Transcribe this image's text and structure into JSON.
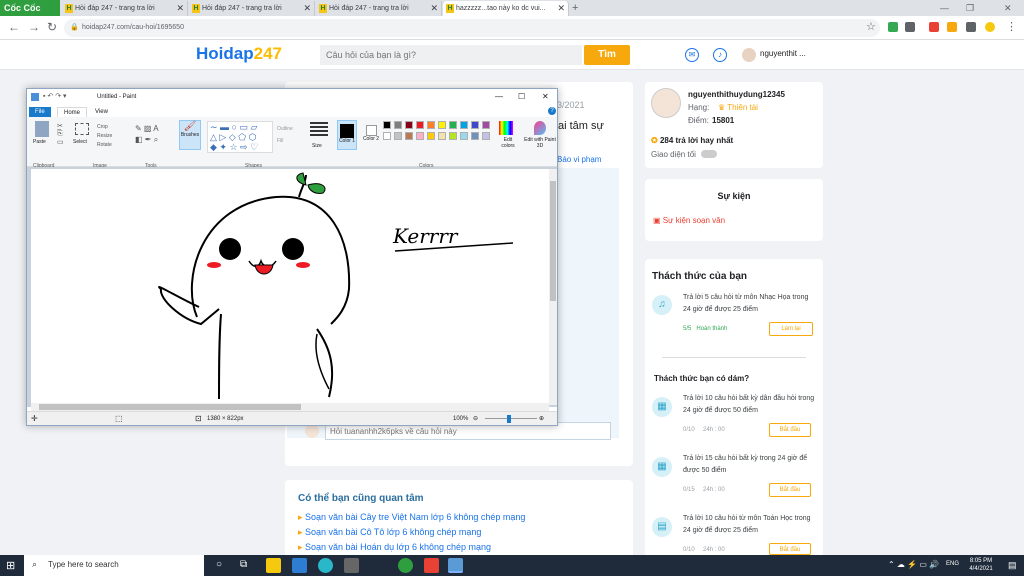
{
  "browser": {
    "brand": "Cốc Cốc",
    "tabs": [
      {
        "title": "Hỏi đáp 247 - trang tra lời"
      },
      {
        "title": "Hỏi đáp 247 - trang tra lời"
      },
      {
        "title": "Hỏi đáp 247 - trang tra lời"
      },
      {
        "title": "hazzzzz...tao này ko dc vui..."
      }
    ],
    "url": "hoidap247.com/cau-hoi/1695650"
  },
  "site": {
    "logo_main": "Hoidap",
    "logo_accent": "247",
    "search_placeholder": "Câu hỏi của bạn là gì?",
    "search_button": "Tìm",
    "username_short": "nguyenthit ..."
  },
  "question": {
    "date_fragment": "3/2021",
    "text_fragment": "ai tâm sự",
    "report_link": "Báo vi phạm",
    "comment_placeholder": "Hỏi tuananhh2k6pks về câu hỏi này"
  },
  "related": {
    "title": "Có thể bạn cũng quan tâm",
    "items": [
      "Soạn văn bài Cây tre Việt Nam lớp 6 không chép mạng",
      "Soạn văn bài Cô Tô lớp 6 không chép mạng",
      "Soạn văn bài Hoán dụ lớp 6 không chép mạng"
    ]
  },
  "profile": {
    "name": "nguyenthithuydung12345",
    "rank_label": "Hạng:",
    "rank_value": "Thiên tài",
    "score_label": "Điểm:",
    "score_value": "15801",
    "best_answers": "284 trả lời hay nhất",
    "dark_mode": "Giao diện tối"
  },
  "event": {
    "title": "Sự kiện",
    "item": "Sự kiện soạn văn"
  },
  "challenges": {
    "title": "Thách thức của bạn",
    "first": {
      "text": "Trả lời 5 câu hỏi  từ môn Nhạc Họa trong 24 giờ để được 25 điểm",
      "progress": "5/5",
      "status": "Hoàn thành",
      "button": "Làm lại"
    },
    "dare_title": "Thách thức bạn có dám?",
    "items": [
      {
        "text": "Trả lời 10 câu hỏi  bất kỳ dân đầu hỏi trong 24 giờ để được 50 điểm",
        "progress": "0/10",
        "time": "24h : 00",
        "button": "Bắt đầu"
      },
      {
        "text": "Trả lời 15 câu hỏi  bất kỳ  trong 24 giờ để được 50 điểm",
        "progress": "0/15",
        "time": "24h : 00",
        "button": "Bắt đầu"
      },
      {
        "text": "Trả lời 10 câu hỏi  từ môn Toán Học trong 24 giờ để được 25 điểm",
        "progress": "0/10",
        "time": "24h : 00",
        "button": "Bắt đầu"
      }
    ]
  },
  "paint": {
    "title": "Untitled - Paint",
    "tabs": [
      "File",
      "Home",
      "View"
    ],
    "groups": [
      "Clipboard",
      "Image",
      "Tools",
      "Shapes",
      "Colors"
    ],
    "tools": {
      "paste": "Paste",
      "select": "Select",
      "crop": "Crop",
      "resize": "Resize",
      "rotate": "Rotate",
      "brushes": "Brushes",
      "outline": "Outline",
      "fill": "Fill",
      "size": "Size",
      "color1": "Color 1",
      "color2": "Color 2",
      "edit_colors": "Edit colors",
      "edit_3d": "Edit with Paint 3D"
    },
    "palette": [
      "#000000",
      "#7f7f7f",
      "#880015",
      "#ed1c24",
      "#ff7f27",
      "#fff200",
      "#22b14c",
      "#00a2e8",
      "#3f48cc",
      "#a349a4",
      "#ffffff",
      "#c3c3c3",
      "#b97a57",
      "#ffaec9",
      "#ffc90e",
      "#efe4b0",
      "#b5e61d",
      "#99d9ea",
      "#7092be",
      "#c8bfe7"
    ],
    "dimensions": "1380 × 822px",
    "zoom": "100%",
    "drawing_text": "Kerrrr"
  },
  "taskbar": {
    "search_placeholder": "Type here to search",
    "lang": "ENG",
    "time": "8:05 PM",
    "date": "4/4/2021"
  }
}
